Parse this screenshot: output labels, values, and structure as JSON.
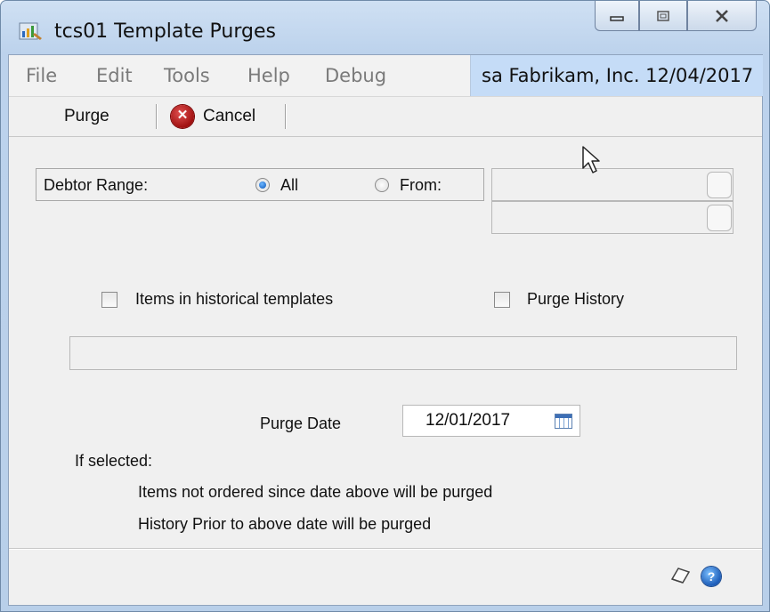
{
  "window": {
    "title": "tcs01 Template Purges"
  },
  "menu": {
    "items": [
      "File",
      "Edit",
      "Tools",
      "Help",
      "Debug"
    ]
  },
  "userinfo": {
    "text": "sa  Fabrikam, Inc.  12/04/2017"
  },
  "toolbar": {
    "purge_label": "Purge",
    "cancel_label": "Cancel"
  },
  "form": {
    "debtor_range_label": "Debtor Range:",
    "all_label": "All",
    "from_label": "From:",
    "range_selected": "All",
    "items_historical_label": "Items in historical templates",
    "purge_history_label": "Purge History",
    "purge_date_label": "Purge Date",
    "purge_date_value": "12/01/2017",
    "if_selected_label": "If selected:",
    "note_items": "Items not ordered since date above will be purged",
    "note_history": "History Prior to above date will be purged"
  },
  "icons": {
    "app": "purge-app-icon",
    "cancel": "cancel-x-icon",
    "calendar": "calendar-icon",
    "note": "note-icon",
    "help": "help-icon"
  }
}
